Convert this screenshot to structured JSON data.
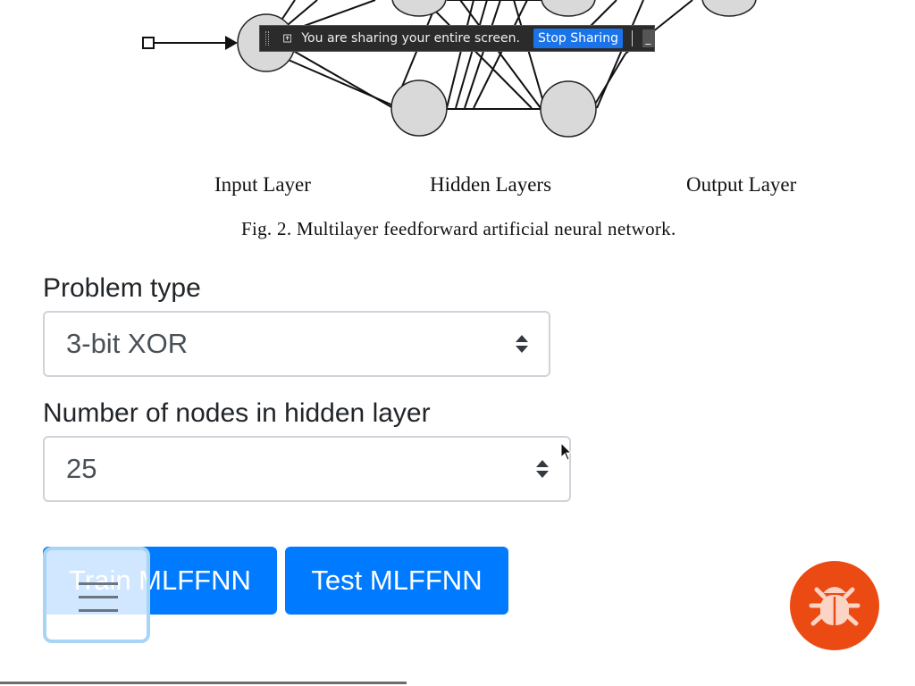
{
  "figure": {
    "labels": {
      "input_layer": "Input Layer",
      "hidden_layers": "Hidden Layers",
      "output_layer": "Output Layer"
    },
    "caption": "Fig. 2. Multilayer feedforward artificial neural network."
  },
  "share_bar": {
    "message": "You are sharing your entire screen.",
    "stop_label": "Stop Sharing",
    "hide_label": "_"
  },
  "form": {
    "problem_type": {
      "label": "Problem type",
      "value": "3-bit XOR"
    },
    "hidden_nodes": {
      "label": "Number of nodes in hidden layer",
      "value": "25"
    },
    "train_label": "Train MLFFNN",
    "test_label": "Test MLFFNN"
  },
  "colors": {
    "primary": "#007bff",
    "bug_button": "#ec4a13",
    "share_bar_bg": "#2b2b2b",
    "stop_button": "#1a73e8"
  },
  "icons": {
    "share": "share-screen-icon",
    "menu": "hamburger-icon",
    "bug": "bug-icon"
  }
}
